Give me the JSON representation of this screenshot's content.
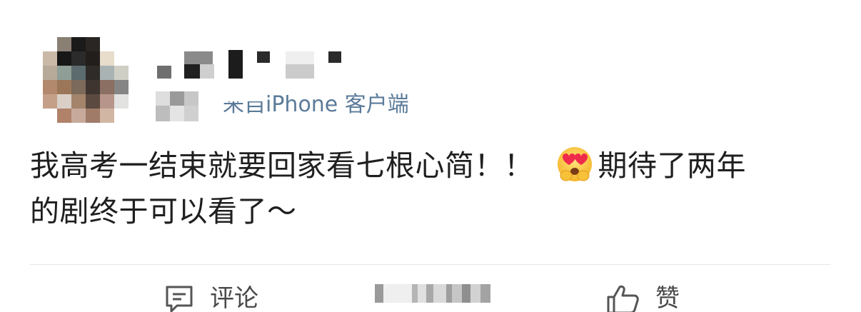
{
  "post": {
    "source": {
      "prefix": "来自",
      "client": "iPhone 客户端"
    },
    "text": {
      "line1_a": "我高考一结束就要回家看七根心简！！",
      "line1_b": "期待了两年",
      "line2": "的剧终于可以看了～"
    },
    "emoji": "heart-eyes-emoji"
  },
  "actions": {
    "comment_label": "评论",
    "like_label": "赞"
  },
  "colors": {
    "source_text": "#5b7b99",
    "body_text": "#1f1f1f",
    "divider": "#e6e6e6",
    "action_icon": "#555555"
  }
}
